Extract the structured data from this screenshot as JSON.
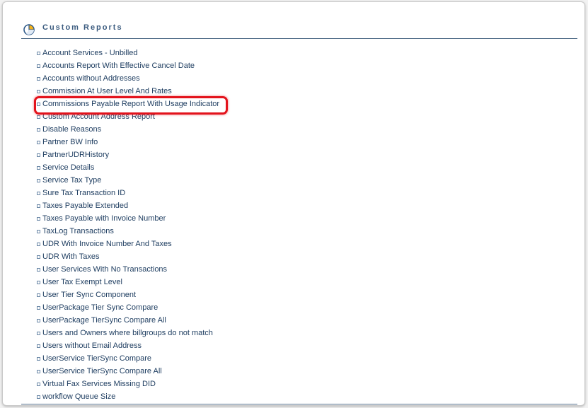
{
  "section": {
    "title": "Custom Reports",
    "icon": "pie-chart-icon"
  },
  "colors": {
    "link": "#1f3e61",
    "title": "#3b5b7f",
    "rule": "#4f6b87",
    "highlight": "#e3131c"
  },
  "highlighted_index": 4,
  "reports": [
    "Account Services - Unbilled",
    "Accounts Report With Effective Cancel Date",
    "Accounts without Addresses",
    "Commission At User Level And Rates",
    "Commissions Payable Report With Usage Indicator",
    "Custom Account Address Report",
    "Disable Reasons",
    "Partner BW Info",
    "PartnerUDRHistory",
    "Service Details",
    "Service Tax Type",
    "Sure Tax Transaction ID",
    "Taxes Payable Extended",
    "Taxes Payable with Invoice Number",
    "TaxLog Transactions",
    "UDR With Invoice Number And Taxes",
    "UDR With Taxes",
    "User Services With No Transactions",
    "User Tax Exempt Level",
    "User Tier Sync Component",
    "UserPackage Tier Sync Compare",
    "UserPackage TierSync Compare All",
    "Users and Owners where billgroups do not match",
    "Users without Email Address",
    "UserService TierSync Compare",
    "UserService TierSync Compare All",
    "Virtual Fax Services Missing DID",
    "workflow Queue Size"
  ]
}
